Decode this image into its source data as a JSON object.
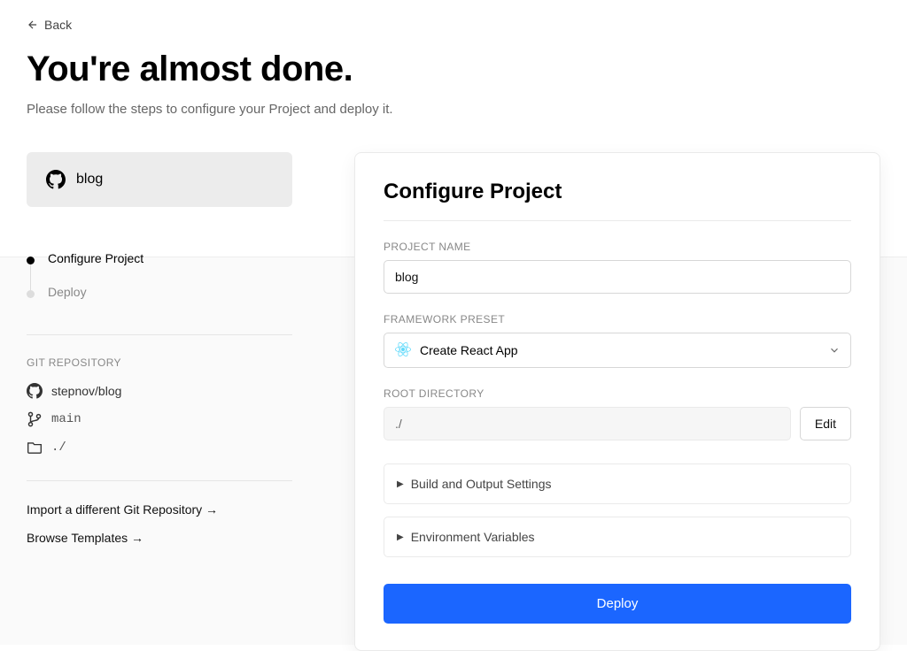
{
  "header": {
    "back_label": "Back",
    "title": "You're almost done.",
    "subtitle": "Please follow the steps to configure your Project and deploy it."
  },
  "sidebar": {
    "repo_chip_name": "blog",
    "steps": [
      {
        "label": "Configure Project",
        "active": true
      },
      {
        "label": "Deploy",
        "active": false
      }
    ],
    "git_section_heading": "GIT REPOSITORY",
    "git_repo_path": "stepnov/blog",
    "git_branch": "main",
    "git_root": "./",
    "action_import": "Import a different Git Repository →",
    "action_browse": "Browse Templates →"
  },
  "card": {
    "title": "Configure Project",
    "project_name_label": "PROJECT NAME",
    "project_name_value": "blog",
    "framework_label": "FRAMEWORK PRESET",
    "framework_value": "Create React App",
    "root_dir_label": "ROOT DIRECTORY",
    "root_dir_value": "./",
    "edit_button": "Edit",
    "collapse_build": "Build and Output Settings",
    "collapse_env": "Environment Variables",
    "deploy_button": "Deploy"
  }
}
